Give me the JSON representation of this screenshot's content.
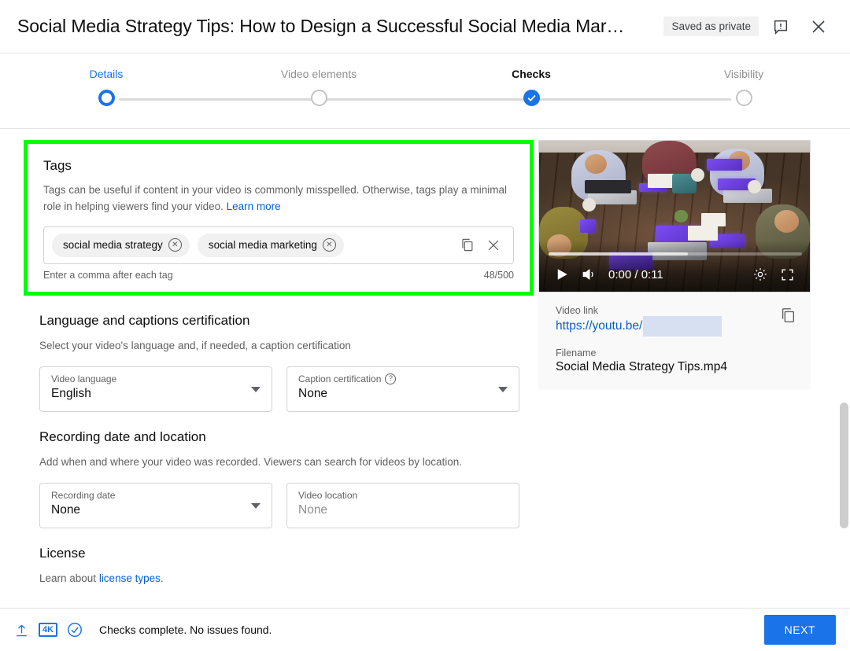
{
  "header": {
    "title": "Social Media Strategy Tips: How to Design a Successful Social Media Mar…",
    "saved_status": "Saved as private",
    "feedback_icon": "feedback-icon",
    "close_icon": "close-icon"
  },
  "stepper": {
    "steps": [
      {
        "label": "Details",
        "state": "ring"
      },
      {
        "label": "Video elements",
        "state": "empty"
      },
      {
        "label": "Checks",
        "state": "filled"
      },
      {
        "label": "Visibility",
        "state": "empty"
      }
    ]
  },
  "tags": {
    "heading": "Tags",
    "description_1": "Tags can be useful if content in your video is commonly misspelled. Otherwise, tags play a minimal role in helping viewers find your video.",
    "learn_more": "Learn more",
    "chips": [
      "social media strategy",
      "social media marketing"
    ],
    "copy_icon": "copy-icon",
    "clear_icon": "clear-icon",
    "hint": "Enter a comma after each tag",
    "counter": "48/500",
    "highlight_color": "#00ff00"
  },
  "language": {
    "heading": "Language and captions certification",
    "description": "Select your video's language and, if needed, a caption certification",
    "video_language_label": "Video language",
    "video_language_value": "English",
    "caption_cert_label": "Caption certification",
    "caption_cert_help": "?",
    "caption_cert_value": "None"
  },
  "recording": {
    "heading": "Recording date and location",
    "description": "Add when and where your video was recorded. Viewers can search for videos by location.",
    "date_label": "Recording date",
    "date_value": "None",
    "location_label": "Video location",
    "location_value": "None"
  },
  "license": {
    "heading": "License",
    "text_prefix": "Learn about ",
    "link": "license types",
    "text_suffix": "."
  },
  "preview": {
    "play_icon": "play-icon",
    "volume_icon": "volume-icon",
    "time": "0:00 / 0:11",
    "settings_icon": "settings-gear-icon",
    "fullscreen_icon": "fullscreen-icon",
    "video_link_label": "Video link",
    "video_link_value": "https://youtu.be/",
    "filename_label": "Filename",
    "filename_value": "Social Media Strategy Tips.mp4",
    "copy_icon": "copy-link-icon"
  },
  "footer": {
    "upload_icon": "upload-icon",
    "quality_badge": "4K",
    "check_icon": "check-circle-icon",
    "status": "Checks complete. No issues found.",
    "next_label": "NEXT",
    "accent_color": "#1a73e8"
  }
}
